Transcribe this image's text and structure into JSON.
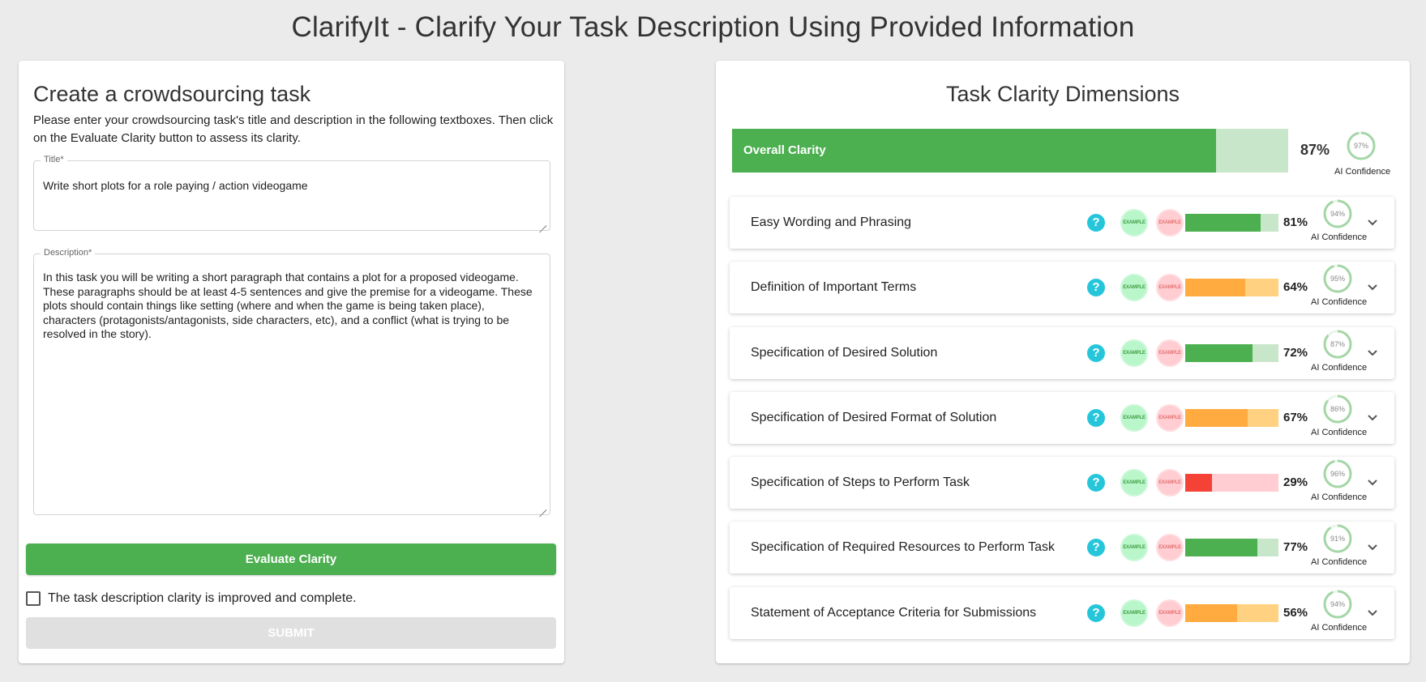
{
  "page": {
    "title": "ClarifyIt - Clarify Your Task Description Using Provided Information"
  },
  "form": {
    "heading": "Create a crowdsourcing task",
    "instructions": "Please enter your crowdsourcing task's title and description in the following textboxes. Then click on the Evaluate Clarity button to assess its clarity.",
    "title_label": "Title*",
    "title_value": "Write short plots for a role paying / action videogame",
    "description_label": "Description*",
    "description_value": "In this task you will be writing a short paragraph that contains a plot for a proposed videogame. These paragraphs should be at least 4-5 sentences and give the premise for a videogame. These plots should contain things like setting (where and when the game is being taken place), characters (protagonists/antagonists, side characters, etc), and a conflict (what is trying to be resolved in the story).",
    "evaluate_label": "Evaluate Clarity",
    "checkbox_label": "The task description clarity is improved and complete.",
    "checkbox_checked": false,
    "submit_label": "SUBMIT"
  },
  "results": {
    "heading": "Task Clarity Dimensions",
    "overall": {
      "label": "Overall Clarity",
      "score": 87,
      "score_text": "87%",
      "confidence": 97,
      "confidence_text": "97%",
      "confidence_label": "AI Confidence"
    },
    "help_icon": "?",
    "stamp_text": "EXAMPLE",
    "dimensions": [
      {
        "label": "Easy Wording and Phrasing",
        "score": 81,
        "score_text": "81%",
        "confidence": 94,
        "confidence_text": "94%",
        "confidence_label": "AI Confidence",
        "level": "good"
      },
      {
        "label": "Definition of Important Terms",
        "score": 64,
        "score_text": "64%",
        "confidence": 95,
        "confidence_text": "95%",
        "confidence_label": "AI Confidence",
        "level": "medium"
      },
      {
        "label": "Specification of Desired Solution",
        "score": 72,
        "score_text": "72%",
        "confidence": 87,
        "confidence_text": "87%",
        "confidence_label": "AI Confidence",
        "level": "good"
      },
      {
        "label": "Specification of Desired Format of Solution",
        "score": 67,
        "score_text": "67%",
        "confidence": 86,
        "confidence_text": "86%",
        "confidence_label": "AI Confidence",
        "level": "medium"
      },
      {
        "label": "Specification of Steps to Perform Task",
        "score": 29,
        "score_text": "29%",
        "confidence": 96,
        "confidence_text": "96%",
        "confidence_label": "AI Confidence",
        "level": "low"
      },
      {
        "label": "Specification of Required Resources to Perform Task",
        "score": 77,
        "score_text": "77%",
        "confidence": 91,
        "confidence_text": "91%",
        "confidence_label": "AI Confidence",
        "level": "good"
      },
      {
        "label": "Statement of Acceptance Criteria for Submissions",
        "score": 56,
        "score_text": "56%",
        "confidence": 94,
        "confidence_text": "94%",
        "confidence_label": "AI Confidence",
        "level": "medium"
      }
    ]
  },
  "colors": {
    "good_fill": "#4caf50",
    "good_track": "#c8e6c9",
    "medium_fill": "#ffab40",
    "medium_track": "#ffd180",
    "low_fill": "#f44336",
    "low_track": "#ffcdd2",
    "gauge_stroke": "#a5d6a7",
    "gauge_track": "#e8f5e9"
  }
}
